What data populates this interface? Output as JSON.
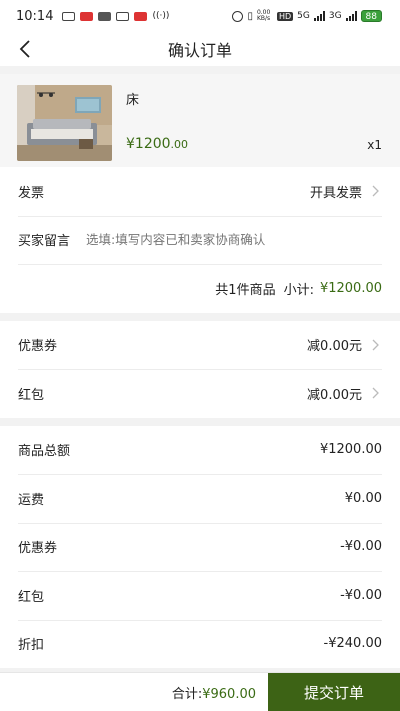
{
  "status_bar": {
    "time": "10:14",
    "network_speed": "0.00 KB/s",
    "hd": "HD",
    "signal1": "5G",
    "signal2": "3G",
    "battery": "88"
  },
  "nav": {
    "title": "确认订单"
  },
  "product": {
    "name": "床",
    "price_main": "¥1200",
    "price_decimal": ".00",
    "qty": "x1"
  },
  "order_info": {
    "invoice_label": "发票",
    "invoice_value": "开具发票",
    "note_label": "买家留言",
    "note_placeholder": "选填:填写内容已和卖家协商确认",
    "summary_count": "共1件商品",
    "summary_label": "小计:",
    "summary_amount": "¥1200.00"
  },
  "discounts": {
    "coupon_label": "优惠券",
    "coupon_value": "减0.00元",
    "redpacket_label": "红包",
    "redpacket_value": "减0.00元"
  },
  "totals": [
    {
      "label": "商品总额",
      "value": "¥1200.00"
    },
    {
      "label": "运费",
      "value": "¥0.00"
    },
    {
      "label": "优惠券",
      "value": "-¥0.00"
    },
    {
      "label": "红包",
      "value": "-¥0.00"
    },
    {
      "label": "折扣",
      "value": "-¥240.00"
    }
  ],
  "bottom": {
    "total_label": "合计:",
    "total_amount": "¥960.00",
    "submit_label": "提交订单"
  },
  "colors": {
    "accent_green": "#3a6b14",
    "button_green": "#3d6315"
  }
}
